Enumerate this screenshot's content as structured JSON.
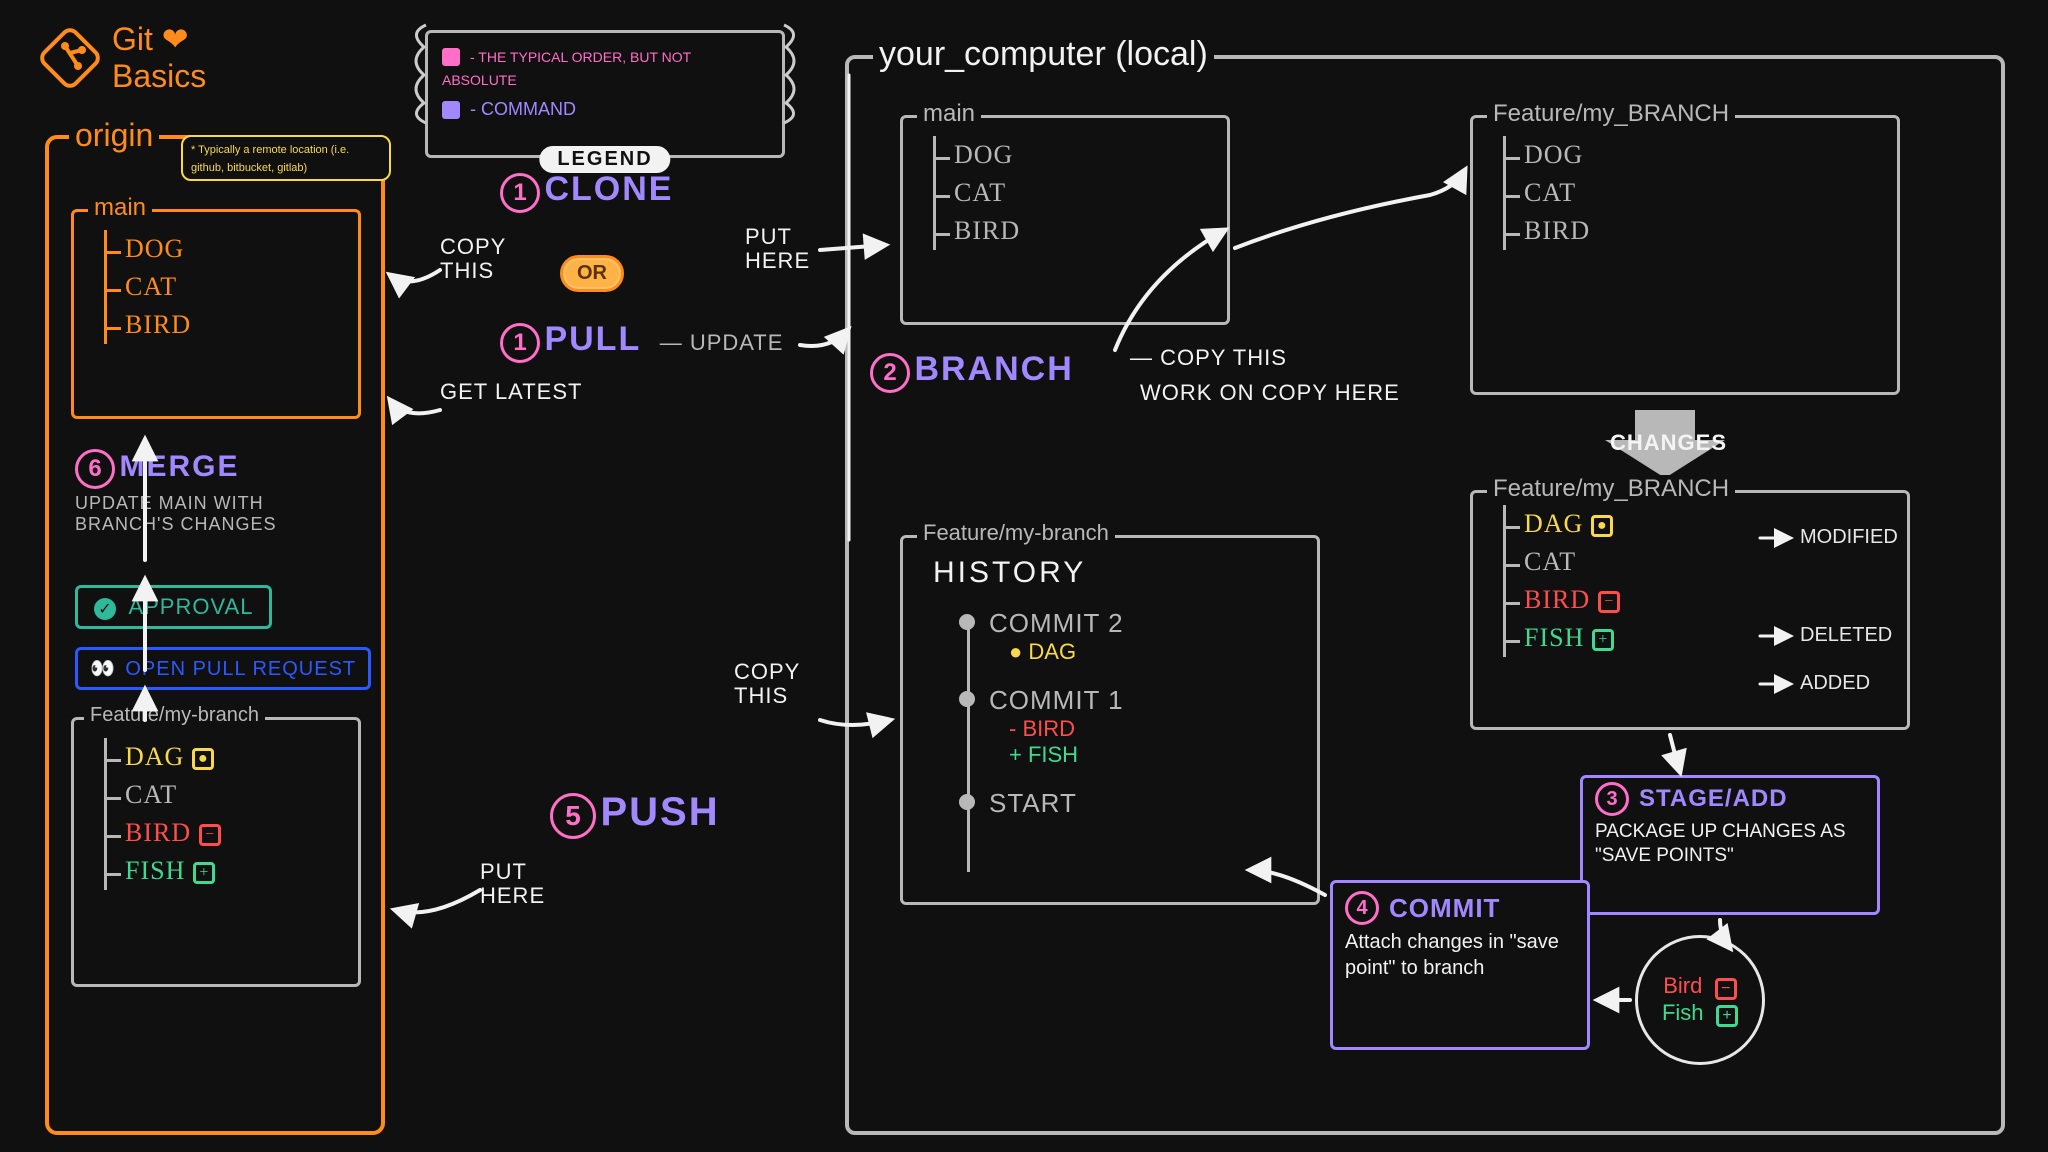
{
  "title": {
    "line1": "Git",
    "line2": "Basics",
    "heart": "❤"
  },
  "legend": {
    "label": "LEGEND",
    "items": [
      {
        "swatch": "#ff6ec7",
        "text": "- THE TYPICAL ORDER, BUT NOT ABSOLUTE"
      },
      {
        "swatch": "#a288ff",
        "text": "- COMMAND"
      }
    ]
  },
  "origin": {
    "label": "origin",
    "note": "* Typically a remote location (i.e. github, bitbucket, gitlab)",
    "main": {
      "label": "main",
      "files": [
        "DOG",
        "CAT",
        "BIRD"
      ]
    },
    "merge_step": "6",
    "merge_cmd": "MERGE",
    "merge_note": "UPDATE MAIN WITH BRANCH'S CHANGES",
    "approval": "APPROVAL",
    "open_pr": "OPEN PULL REQUEST",
    "feature": {
      "label": "Feature/my-branch",
      "files": [
        {
          "name": "DAG",
          "status": "modified"
        },
        {
          "name": "CAT",
          "status": "none"
        },
        {
          "name": "BIRD",
          "status": "deleted"
        },
        {
          "name": "FISH",
          "status": "added"
        }
      ]
    }
  },
  "steps": {
    "clone": {
      "num": "1",
      "cmd": "CLONE",
      "copy": "COPY THIS",
      "put": "PUT HERE"
    },
    "or": "OR",
    "pull": {
      "num": "1",
      "cmd": "PULL",
      "note": "UPDATE",
      "get": "get latest"
    },
    "branch": {
      "num": "2",
      "cmd": "BRANCH",
      "copy": "COPY THIS",
      "work": "WORK ON COPY HERE"
    },
    "stage": {
      "num": "3",
      "cmd": "STAGE/ADD",
      "note": "PACKAGE UP CHANGES AS \"SAVE POINTS\""
    },
    "commit": {
      "num": "4",
      "cmd": "COMMIT",
      "note": "Attach changes in \"save point\" to branch"
    },
    "push": {
      "num": "5",
      "cmd": "PUSH",
      "copy": "COPY THIS",
      "put": "PUT HERE"
    }
  },
  "local": {
    "label": "your_computer (local)",
    "main": {
      "label": "main",
      "files": [
        "DOG",
        "CAT",
        "BIRD"
      ]
    },
    "feature1": {
      "label": "Feature/my_BRANCH",
      "files": [
        "DOG",
        "CAT",
        "BIRD"
      ]
    },
    "changes_label": "CHANGES",
    "feature2": {
      "label": "Feature/my_BRANCH",
      "files": [
        {
          "name": "DAG",
          "status": "modified",
          "status_label": "MODIFIED"
        },
        {
          "name": "CAT",
          "status": "none",
          "status_label": ""
        },
        {
          "name": "BIRD",
          "status": "deleted",
          "status_label": "DELETED"
        },
        {
          "name": "FISH",
          "status": "added",
          "status_label": "ADDED"
        }
      ]
    },
    "history": {
      "label": "Feature/my-branch",
      "sublabel": "HISTORY",
      "commits": [
        {
          "title": "COMMIT 2",
          "items": [
            {
              "sym": "●",
              "text": "DAG",
              "color": "yellow"
            }
          ]
        },
        {
          "title": "COMMIT 1",
          "items": [
            {
              "sym": "-",
              "text": "BIRD",
              "color": "red"
            },
            {
              "sym": "+",
              "text": "FISH",
              "color": "green"
            }
          ]
        },
        {
          "title": "START",
          "items": []
        }
      ]
    },
    "save_point": {
      "items": [
        {
          "name": "Bird",
          "status": "deleted"
        },
        {
          "name": "Fish",
          "status": "added"
        }
      ]
    }
  }
}
